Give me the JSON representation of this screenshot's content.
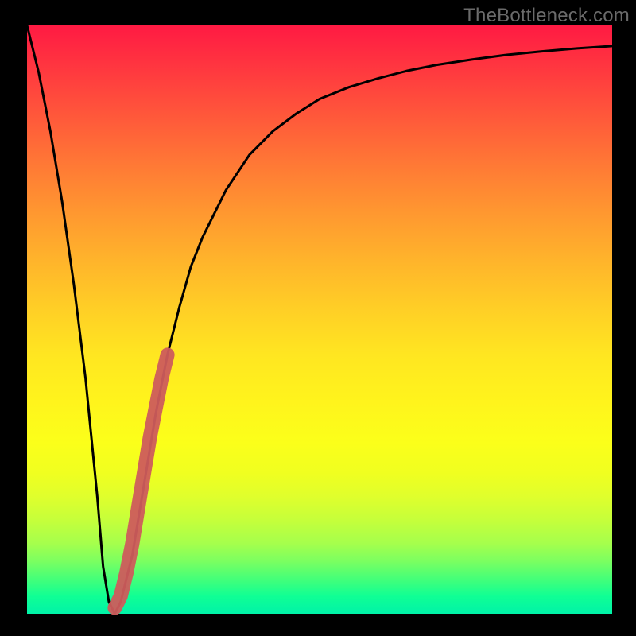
{
  "watermark": "TheBottleneck.com",
  "chart_data": {
    "type": "line",
    "title": "",
    "xlabel": "",
    "ylabel": "",
    "xlim": [
      0,
      100
    ],
    "ylim": [
      0,
      100
    ],
    "series": [
      {
        "name": "bottleneck-curve",
        "x": [
          0,
          2,
          4,
          6,
          8,
          10,
          12,
          13,
          14,
          15,
          16,
          18,
          20,
          22,
          24,
          26,
          28,
          30,
          34,
          38,
          42,
          46,
          50,
          55,
          60,
          65,
          70,
          76,
          82,
          88,
          94,
          100
        ],
        "values": [
          100,
          92,
          82,
          70,
          56,
          40,
          20,
          8,
          2,
          0,
          2,
          10,
          22,
          34,
          44,
          52,
          59,
          64,
          72,
          78,
          82,
          85,
          87.5,
          89.5,
          91,
          92.3,
          93.3,
          94.2,
          95,
          95.6,
          96.1,
          96.5
        ]
      }
    ],
    "highlight_segment": {
      "name": "recommended-range",
      "x": [
        15,
        16,
        17,
        18,
        19,
        20,
        21,
        22,
        23,
        24
      ],
      "values": [
        1,
        3,
        7,
        12,
        18,
        24,
        30,
        35,
        40,
        44
      ]
    },
    "colors": {
      "curve": "#000000",
      "highlight": "#cd5c5c",
      "gradient_top": "#ff1a43",
      "gradient_bottom": "#00f3a8",
      "frame": "#000000"
    }
  }
}
